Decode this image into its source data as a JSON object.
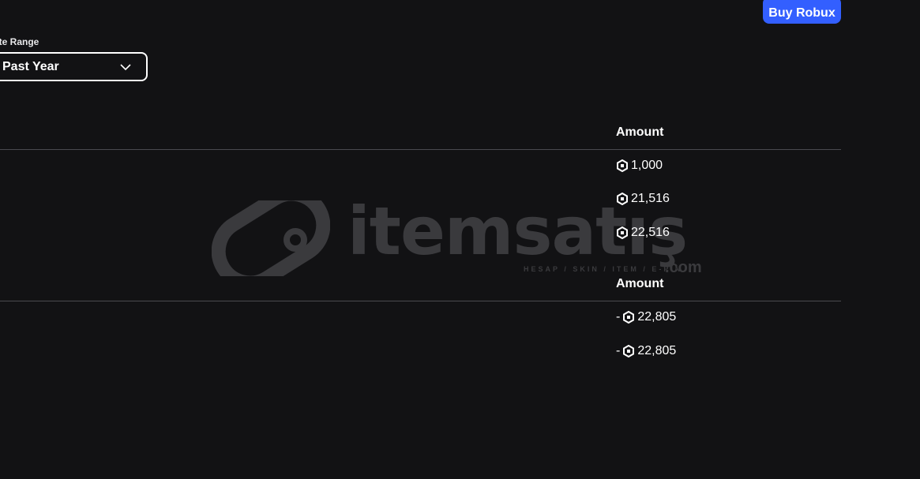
{
  "header": {
    "buy_button_label": "Buy Robux"
  },
  "filter": {
    "label": "ate Range",
    "selected": "Past Year"
  },
  "table1": {
    "amount_header": "Amount",
    "rows": [
      {
        "amount": "1,000"
      },
      {
        "amount": "21,516"
      },
      {
        "amount": "22,516"
      }
    ]
  },
  "table2": {
    "amount_header": "Amount",
    "rows": [
      {
        "sign": "-",
        "amount": "22,805"
      },
      {
        "sign": "-",
        "amount": "22,805"
      }
    ]
  },
  "watermark": {
    "brand": "itemsatış",
    "tagline": "HESAP / SKIN / ITEM / E-PIN",
    "suffix": ".com"
  },
  "icons": {
    "currency": "robux-icon",
    "dropdown": "chevron-down-icon"
  },
  "colors": {
    "background": "#121214",
    "accent": "#335fff",
    "divider": "#4a4a4f",
    "watermark": "#3d3d40"
  }
}
